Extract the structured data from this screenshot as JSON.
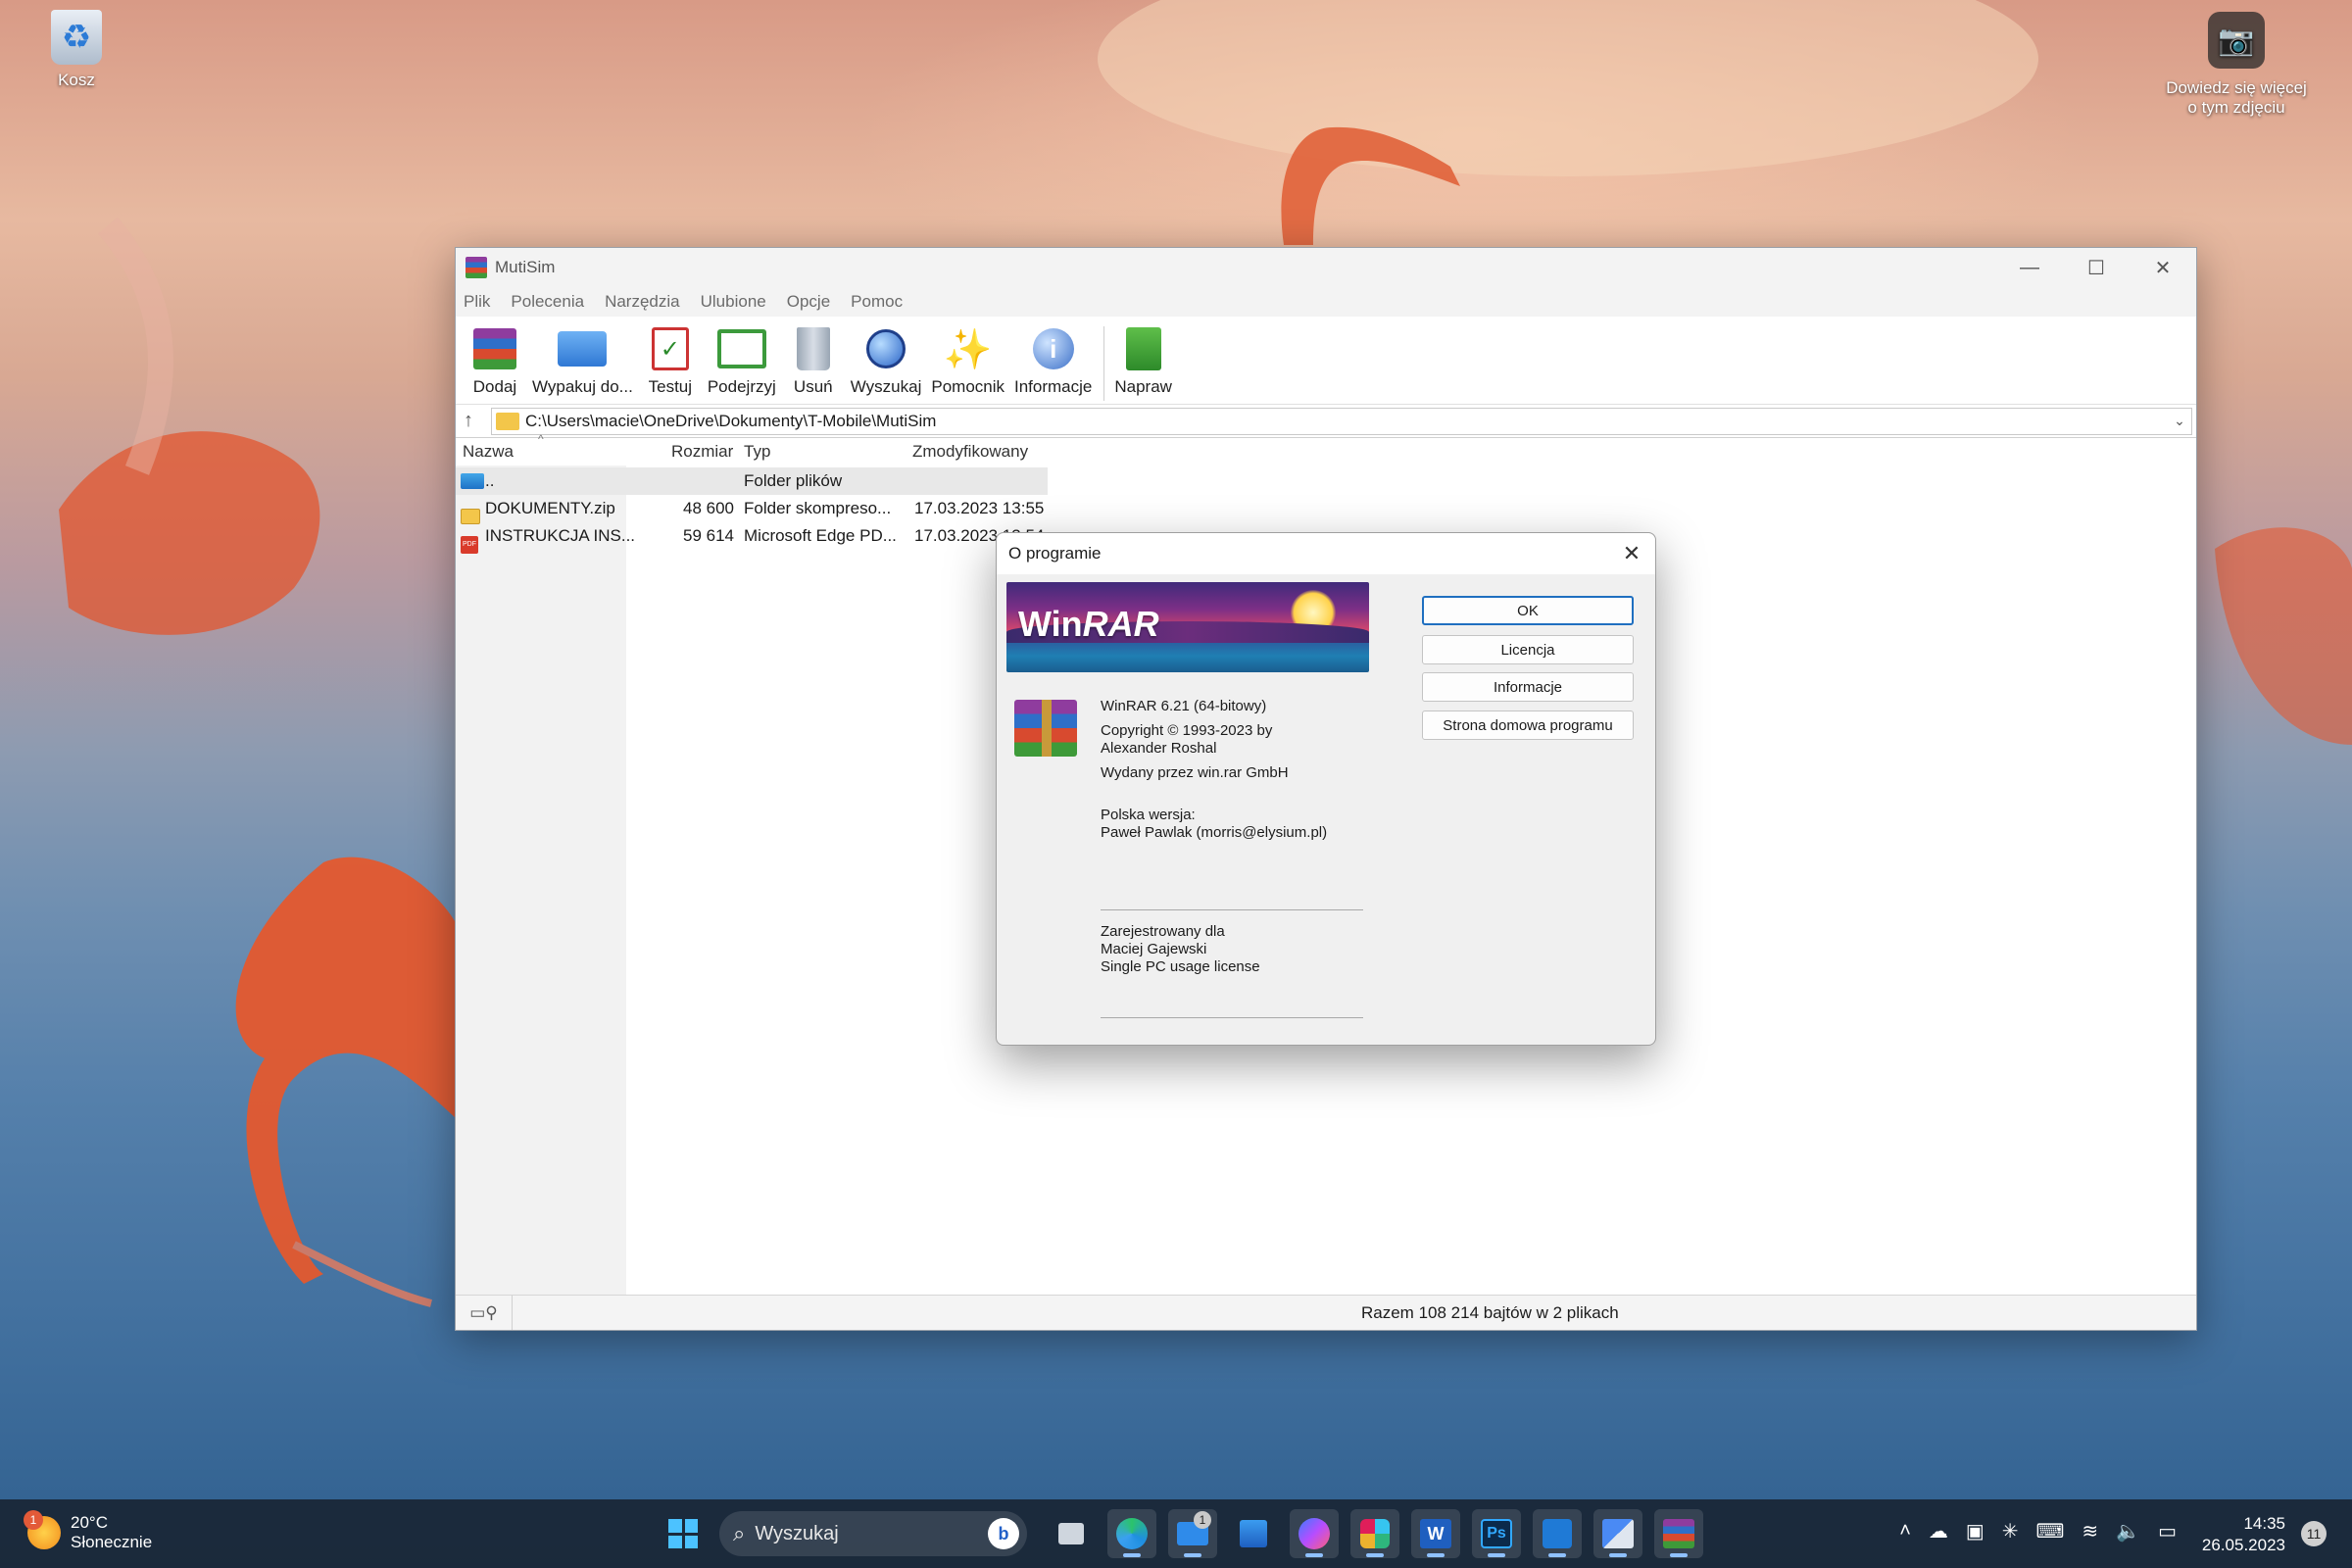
{
  "desktop": {
    "recycle_bin_label": "Kosz",
    "learn_more_line1": "Dowiedz się więcej",
    "learn_more_line2": "o tym zdjęciu"
  },
  "window": {
    "title": "MutiSim",
    "controls": {
      "minimize": "—",
      "maximize": "☐",
      "close": "✕"
    },
    "menu": [
      "Plik",
      "Polecenia",
      "Narzędzia",
      "Ulubione",
      "Opcje",
      "Pomoc"
    ],
    "toolbar": [
      {
        "label": "Dodaj",
        "icon": "add-archive-icon"
      },
      {
        "label": "Wypakuj do...",
        "icon": "extract-icon"
      },
      {
        "label": "Testuj",
        "icon": "test-icon"
      },
      {
        "label": "Podejrzyj",
        "icon": "view-icon"
      },
      {
        "label": "Usuń",
        "icon": "delete-icon"
      },
      {
        "label": "Wyszukaj",
        "icon": "find-icon"
      },
      {
        "label": "Pomocnik",
        "icon": "wizard-icon"
      },
      {
        "label": "Informacje",
        "icon": "info-icon"
      },
      {
        "label": "Napraw",
        "icon": "repair-icon"
      }
    ],
    "address_path": "C:\\Users\\macie\\OneDrive\\Dokumenty\\T-Mobile\\MutiSim",
    "columns": {
      "name": "Nazwa",
      "size": "Rozmiar",
      "type": "Typ",
      "modified": "Zmodyfikowany"
    },
    "files": [
      {
        "name": "..",
        "size": "",
        "type": "Folder plików",
        "modified": ""
      },
      {
        "name": "DOKUMENTY.zip",
        "size": "48 600",
        "type": "Folder skompreso...",
        "modified": "17.03.2023 13:55"
      },
      {
        "name": "INSTRUKCJA INS...",
        "size": "59 614",
        "type": "Microsoft Edge PD...",
        "modified": "17.03.2023 13:54"
      }
    ],
    "status": "Razem 108 214 bajtów w 2 plikach"
  },
  "dialog": {
    "title": "O programie",
    "banner_logo_a": "Win",
    "banner_logo_b": "RAR",
    "version": "WinRAR 6.21 (64-bitowy)",
    "copyright": "Copyright © 1993-2023 by",
    "author": "Alexander Roshal",
    "publisher": "Wydany przez win.rar GmbH",
    "polish_version_label": "Polska wersja:",
    "polish_translator": "Paweł Pawlak (morris@elysium.pl)",
    "registered_label": "Zarejestrowany dla",
    "registered_name": "Maciej Gajewski",
    "license": "Single PC usage license",
    "buttons": {
      "ok": "OK",
      "license": "Licencja",
      "info": "Informacje",
      "homepage": "Strona domowa programu"
    }
  },
  "taskbar": {
    "weather_temp": "20°C",
    "weather_desc": "Słonecznie",
    "weather_badge": "1",
    "search_placeholder": "Wyszukaj",
    "mail_badge": "1",
    "time": "14:35",
    "date": "26.05.2023",
    "notifications": "11"
  }
}
